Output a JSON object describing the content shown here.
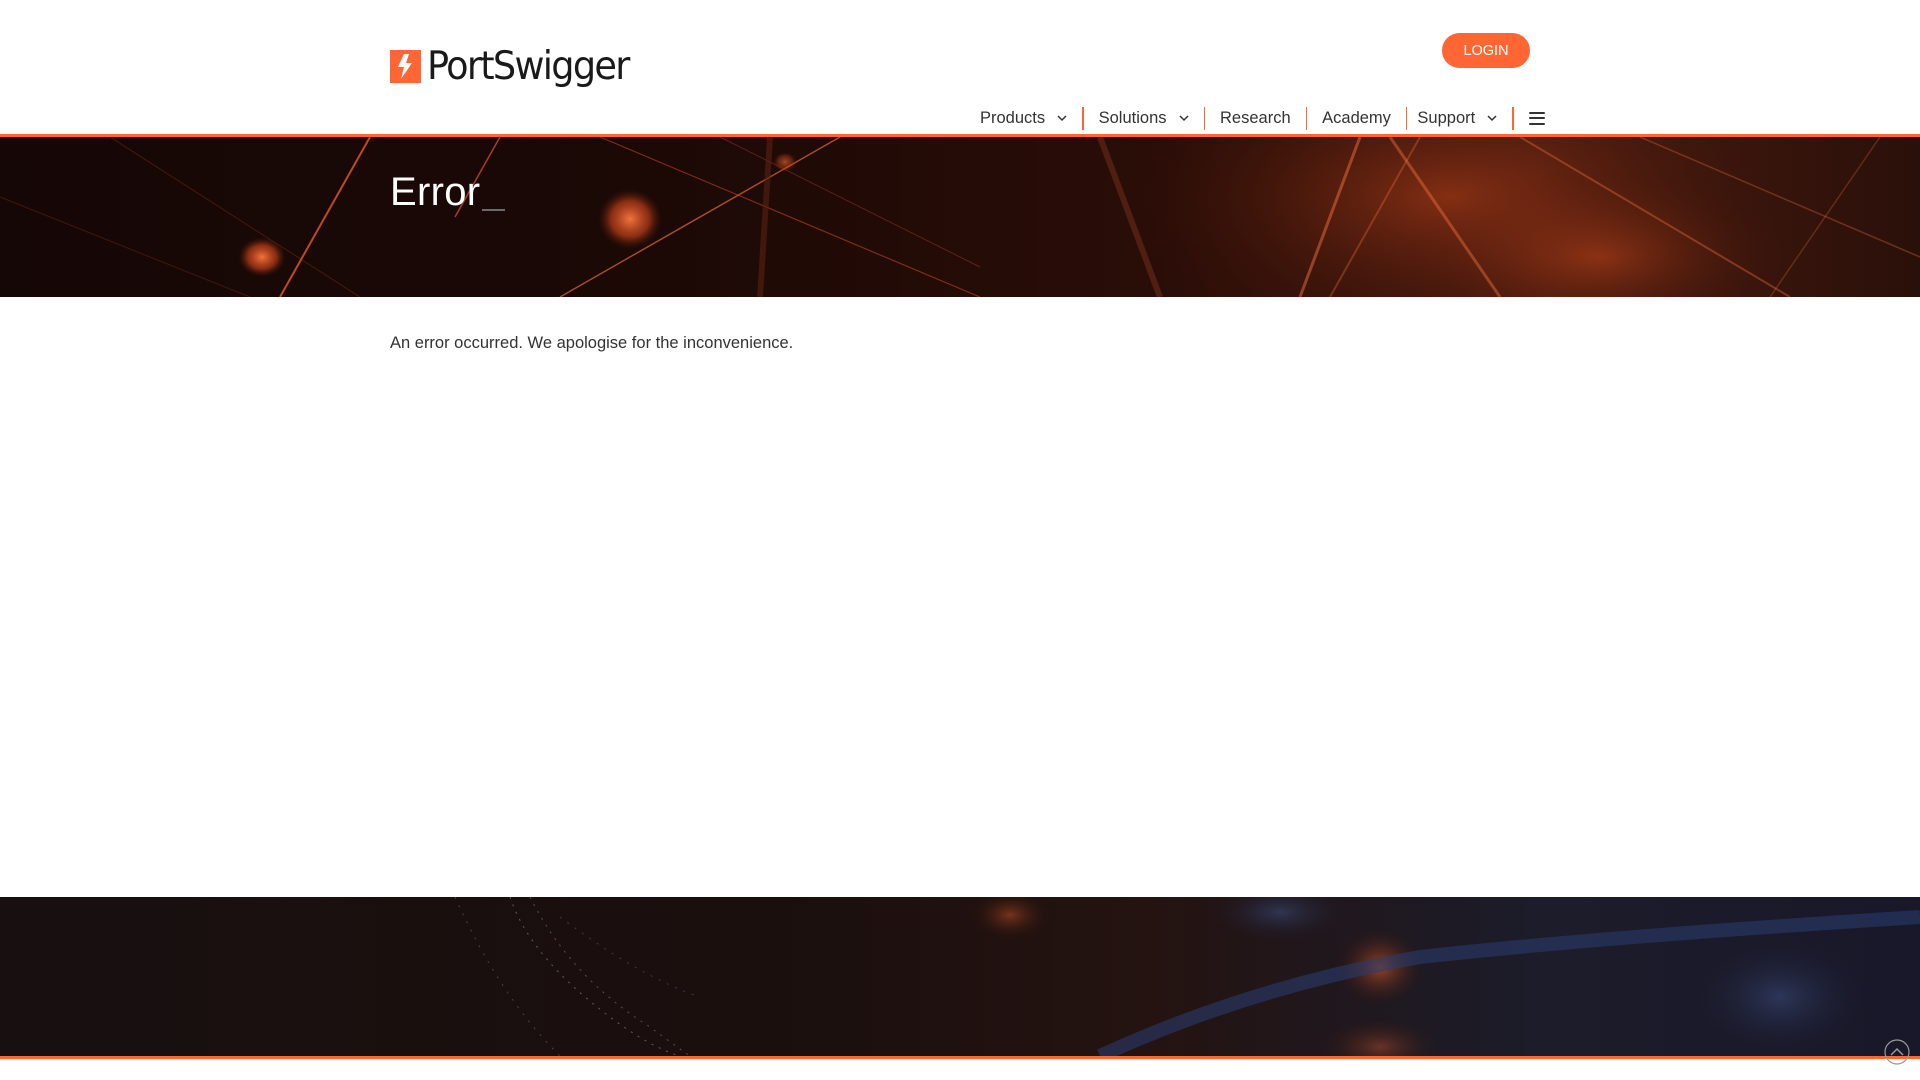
{
  "brand": {
    "name": "PortSwigger",
    "accent_color": "#ff6633"
  },
  "header": {
    "login_label": "LOGIN",
    "nav": [
      {
        "label": "Products",
        "has_dropdown": true
      },
      {
        "label": "Solutions",
        "has_dropdown": true
      },
      {
        "label": "Research",
        "has_dropdown": false
      },
      {
        "label": "Academy",
        "has_dropdown": false
      },
      {
        "label": "Support",
        "has_dropdown": true
      }
    ],
    "menu_icon": "hamburger-icon"
  },
  "hero": {
    "title": "Error"
  },
  "main": {
    "message": "An error occurred. We apologise for the inconvenience."
  },
  "footer": {
    "scroll_top_icon": "chevron-up-circle-icon"
  }
}
